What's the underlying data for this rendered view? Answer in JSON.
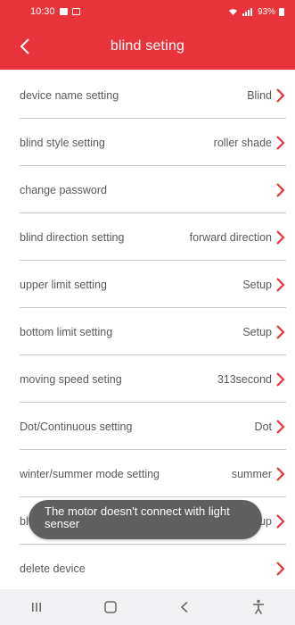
{
  "status_bar": {
    "time": "10:30",
    "battery": "93%"
  },
  "header": {
    "title": "blind seting"
  },
  "settings": [
    {
      "label": "device name setting",
      "value": "Blind"
    },
    {
      "label": "blind style setting",
      "value": "roller shade"
    },
    {
      "label": "change password",
      "value": ""
    },
    {
      "label": "blind direction setting",
      "value": "forward direction"
    },
    {
      "label": "upper limit setting",
      "value": "Setup"
    },
    {
      "label": "bottom limit setting",
      "value": "Setup"
    },
    {
      "label": "moving speed seting",
      "value": "313second"
    },
    {
      "label": "Dot/Continuous setting",
      "value": "Dot"
    },
    {
      "label": "winter/summer mode setting",
      "value": "summer"
    },
    {
      "label": "bl",
      "value": "Setup"
    },
    {
      "label": "delete device",
      "value": ""
    }
  ],
  "toast": {
    "message": "The motor doesn't connect with light senser"
  },
  "colors": {
    "accent": "#e9333b",
    "chevron": "#e9333b",
    "text": "#5a5a5a",
    "toast_bg": "#5f5f5f"
  },
  "nav_icons": [
    "recent-apps-icon",
    "home-icon",
    "back-icon",
    "accessibility-icon"
  ]
}
